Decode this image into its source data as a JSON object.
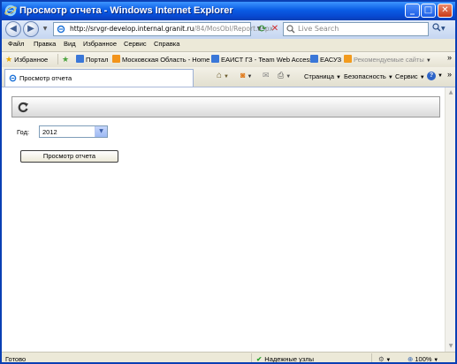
{
  "window": {
    "title": "Просмотр отчета - Windows Internet Explorer",
    "minimize": "_",
    "maximize": "□",
    "close": "✕"
  },
  "address": {
    "url_host": "http://srvgr-develop.internal.granit.ru",
    "url_path": "/84/MosObl/Report.aspx",
    "search_placeholder": "Live Search"
  },
  "menu": {
    "items": [
      "Файл",
      "Правка",
      "Вид",
      "Избранное",
      "Сервис",
      "Справка"
    ]
  },
  "favorites": {
    "label": "Избранное",
    "links": [
      "Портал",
      "Московская Область - Home",
      "ЕАИСТ ГЗ - Team Web Access",
      "ЕАСУЗ",
      "Рекомендуемые сайты"
    ],
    "more": "»"
  },
  "tabs": {
    "active": "Просмотр отчета"
  },
  "command_bar": {
    "page": "Страница",
    "security": "Безопасность",
    "service": "Сервис"
  },
  "report": {
    "year_label": "Год:",
    "year_value": "2012",
    "view_button": "Просмотр отчета"
  },
  "status": {
    "text": "Готово",
    "zone": "Надежные узлы",
    "zoom": "100%"
  },
  "colors": {
    "titlebar": "#0a5ce5",
    "status_check": "#27a22a"
  }
}
